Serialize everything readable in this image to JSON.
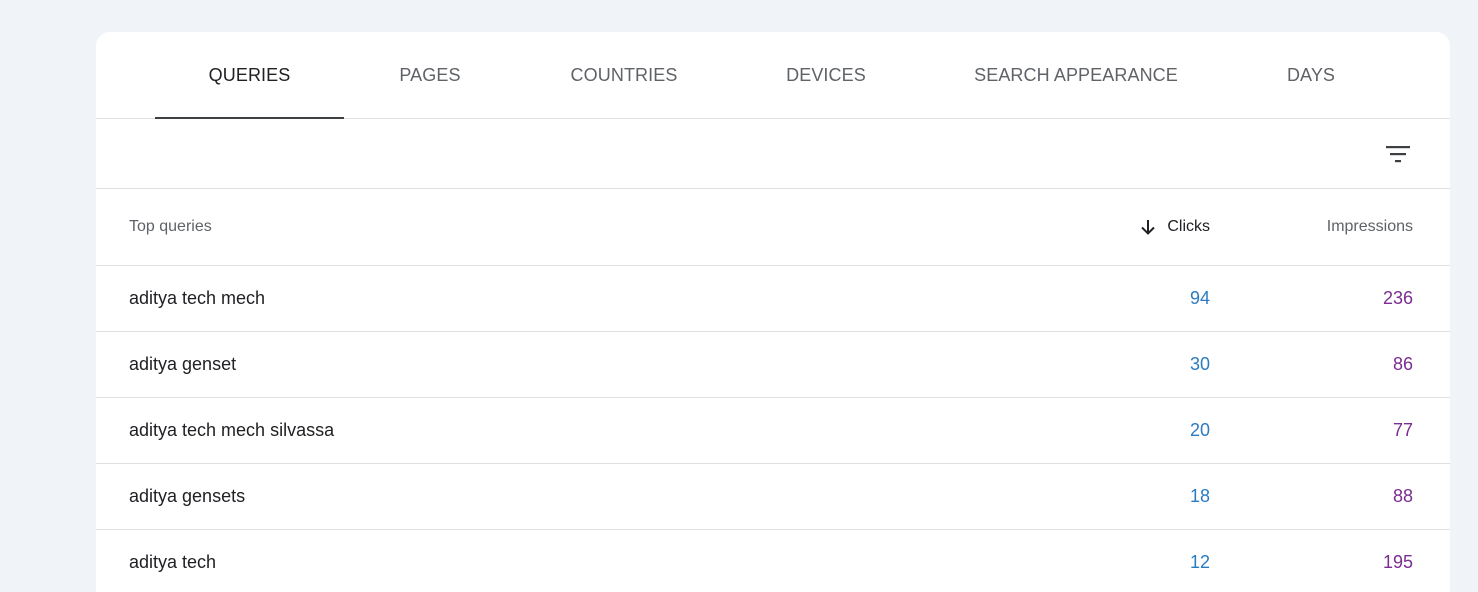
{
  "tabs": [
    {
      "label": "QUERIES",
      "active": true
    },
    {
      "label": "PAGES",
      "active": false
    },
    {
      "label": "COUNTRIES",
      "active": false
    },
    {
      "label": "DEVICES",
      "active": false
    },
    {
      "label": "SEARCH APPEARANCE",
      "active": false
    },
    {
      "label": "DAYS",
      "active": false
    }
  ],
  "filter": {
    "icon": "filter-list-icon"
  },
  "table": {
    "headers": {
      "query": "Top queries",
      "clicks": "Clicks",
      "impressions": "Impressions"
    },
    "sort": {
      "column": "clicks",
      "direction": "descending",
      "icon": "arrow-down-icon"
    },
    "rows": [
      {
        "query": "aditya tech mech",
        "clicks": "94",
        "impressions": "236"
      },
      {
        "query": "aditya genset",
        "clicks": "30",
        "impressions": "86"
      },
      {
        "query": "aditya tech mech silvassa",
        "clicks": "20",
        "impressions": "77"
      },
      {
        "query": "aditya gensets",
        "clicks": "18",
        "impressions": "88"
      },
      {
        "query": "aditya tech",
        "clicks": "12",
        "impressions": "195"
      }
    ]
  },
  "colors": {
    "background": "#f0f3f8",
    "card": "#ffffff",
    "clicks": "#2b7bc0",
    "impressions": "#7b2d90",
    "tab_indicator": "#3c4043"
  }
}
